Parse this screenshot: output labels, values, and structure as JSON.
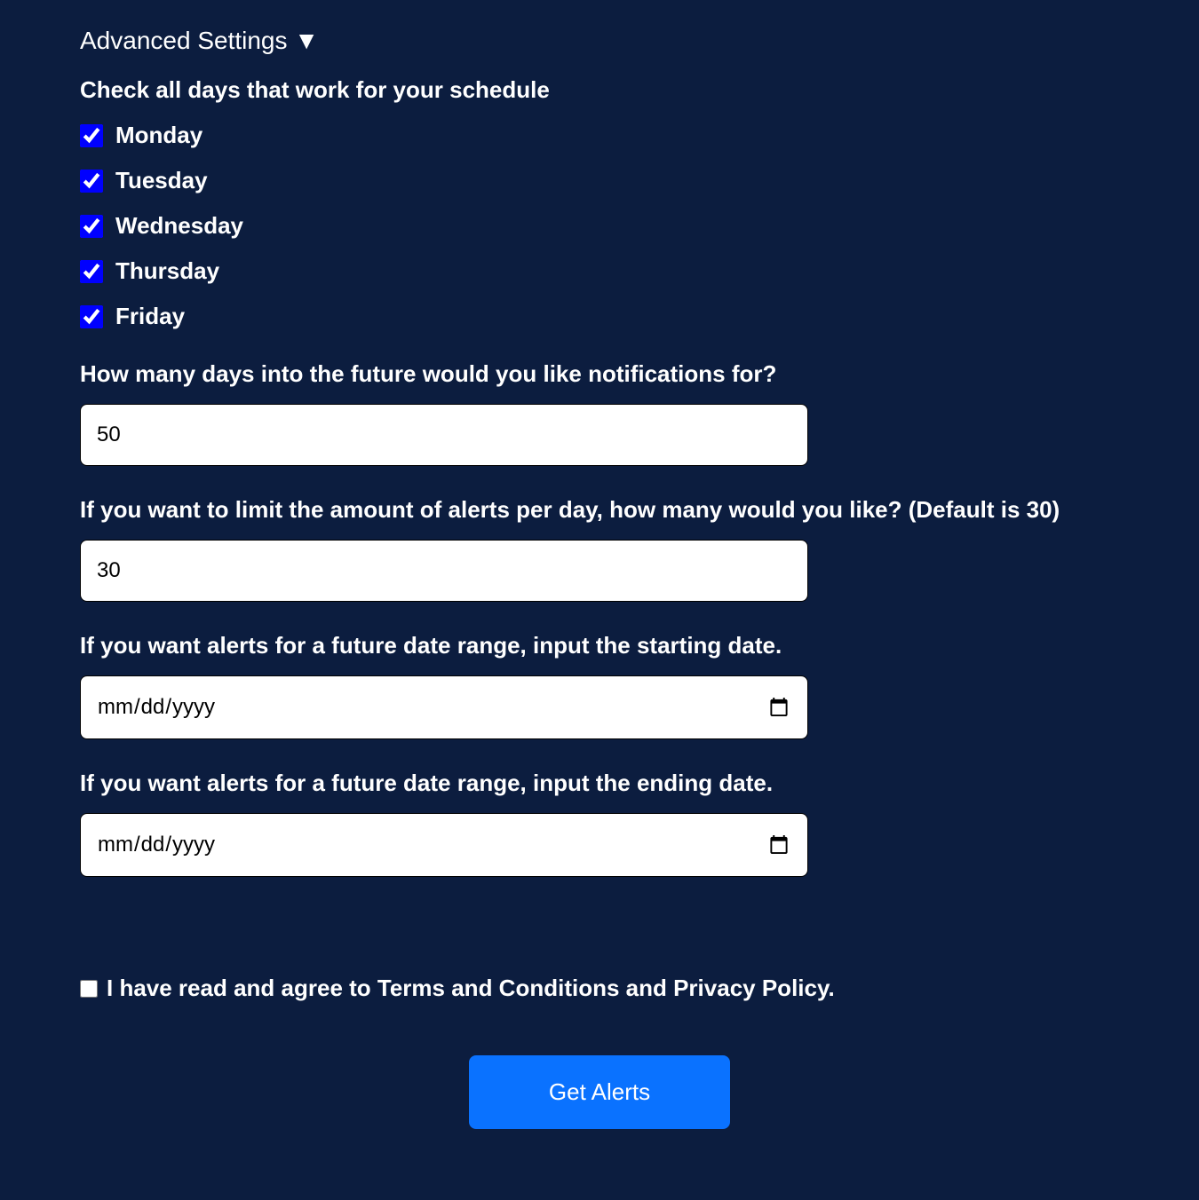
{
  "header": {
    "advanced_settings": "Advanced Settings ▼"
  },
  "schedule": {
    "heading": "Check all days that work for your schedule",
    "days": [
      {
        "label": "Monday",
        "checked": true
      },
      {
        "label": "Tuesday",
        "checked": true
      },
      {
        "label": "Wednesday",
        "checked": true
      },
      {
        "label": "Thursday",
        "checked": true
      },
      {
        "label": "Friday",
        "checked": true
      }
    ]
  },
  "future_days": {
    "label": "How many days into the future would you like notifications for?",
    "value": "50"
  },
  "alerts_limit": {
    "label": "If you want to limit the amount of alerts per day, how many would you like? (Default is 30)",
    "value": "30"
  },
  "start_date": {
    "label": "If you want alerts for a future date range, input the starting date.",
    "placeholder": "mm/dd/yyyy",
    "value": ""
  },
  "end_date": {
    "label": "If you want alerts for a future date range, input the ending date.",
    "placeholder": "mm/dd/yyyy",
    "value": ""
  },
  "terms": {
    "label": "I have read and agree to Terms and Conditions and Privacy Policy.",
    "checked": false
  },
  "submit": {
    "label": "Get Alerts"
  }
}
